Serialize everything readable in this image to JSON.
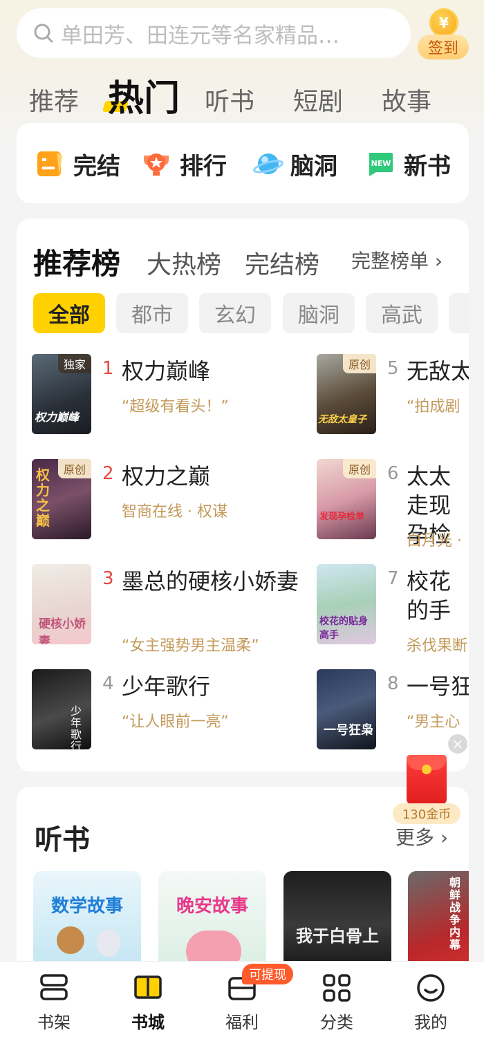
{
  "search": {
    "placeholder": "单田芳、田连元等名家精品…"
  },
  "signin": {
    "coin": "¥",
    "label": "签到"
  },
  "tabs": [
    "推荐",
    "热门",
    "听书",
    "短剧",
    "故事"
  ],
  "quick": [
    {
      "label": "完结",
      "icon": "checklist-icon"
    },
    {
      "label": "排行",
      "icon": "trophy-icon"
    },
    {
      "label": "脑洞",
      "icon": "planet-icon"
    },
    {
      "label": "新书",
      "icon": "new-badge-icon",
      "badge": "NEW"
    }
  ],
  "ranking": {
    "tabs": [
      "推荐榜",
      "大热榜",
      "完结榜"
    ],
    "full_list": "完整榜单",
    "chips": [
      "全部",
      "都市",
      "玄幻",
      "脑洞",
      "高武"
    ],
    "books": [
      {
        "rank": "1",
        "title": "权力巅峰",
        "desc": "“超级有看头！”",
        "badge": "独家",
        "cover_text": "权力巅峰"
      },
      {
        "rank": "2",
        "title": "权力之巅",
        "desc": "智商在线 · 权谋",
        "badge": "原创",
        "cover_text": "权力之巅"
      },
      {
        "rank": "3",
        "title": "墨总的硬核小娇妻",
        "desc": "“女主强势男主温柔”",
        "badge": "",
        "cover_text": "硬核小娇妻"
      },
      {
        "rank": "4",
        "title": "少年歌行",
        "desc": "“让人眼前一亮”",
        "badge": "",
        "cover_text": "少年歌行"
      },
      {
        "rank": "5",
        "title": "无敌太",
        "desc": "“拍成剧",
        "badge": "原创",
        "cover_text": "无敌太皇子"
      },
      {
        "rank": "6",
        "title": "太太走现孕检",
        "desc": "白月光 ·",
        "badge": "原创",
        "cover_text": "发现孕检单"
      },
      {
        "rank": "7",
        "title": "校花的手",
        "desc": "杀伐果断",
        "badge": "",
        "cover_text": "校花的贴身高手"
      },
      {
        "rank": "8",
        "title": "一号狂",
        "desc": "“男主心",
        "badge": "",
        "cover_text": "一号狂枭"
      }
    ]
  },
  "listen": {
    "title": "听书",
    "more": "更多",
    "items": [
      "数学故事",
      "晚安故事",
      "我于白骨上",
      "朝鲜战争内幕"
    ]
  },
  "packet": {
    "label": "130金币",
    "close": "×"
  },
  "nav": {
    "items": [
      "书架",
      "书城",
      "福利",
      "分类",
      "我的"
    ],
    "badge": "可提现"
  }
}
